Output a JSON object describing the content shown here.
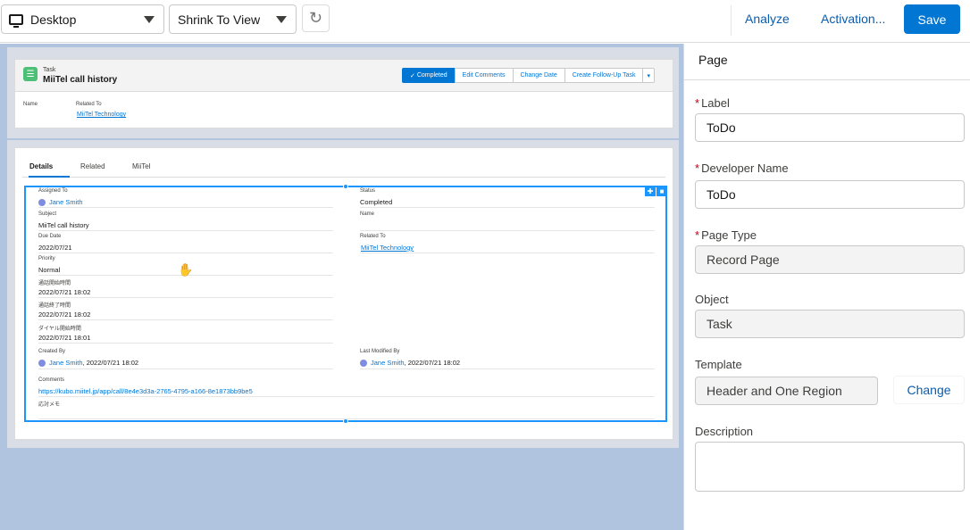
{
  "toolbar": {
    "device_select": "Desktop",
    "view_select": "Shrink To View",
    "refresh_icon": "refresh-icon",
    "analyze": "Analyze",
    "activation": "Activation...",
    "save": "Save"
  },
  "canvas": {
    "header": {
      "object_label": "Task",
      "title": "MiiTel call history",
      "buttons": [
        "Completed",
        "Edit Comments",
        "Change Date",
        "Create Follow-Up Task"
      ],
      "highlights": [
        {
          "label": "Name",
          "value": ""
        },
        {
          "label": "Related To",
          "value": "MiiTel Technology"
        }
      ]
    },
    "tabs": [
      "Details",
      "Related",
      "MiiTel"
    ],
    "fields_left": [
      {
        "label": "Assigned To",
        "value": "Jane Smith",
        "link": true
      },
      {
        "label": "Subject",
        "value": "MiiTel call history",
        "link": false
      },
      {
        "label": "Due Date",
        "value": "2022/07/21",
        "link": false
      },
      {
        "label": "Priority",
        "value": "Normal",
        "link": false
      },
      {
        "label": "通話開始時間",
        "value": "2022/07/21 18:02",
        "link": false
      },
      {
        "label": "通話終了時間",
        "value": "2022/07/21 18:02",
        "link": false
      },
      {
        "label": "ダイヤル開始時間",
        "value": "2022/07/21 18:01",
        "link": false
      }
    ],
    "fields_right": [
      {
        "label": "Status",
        "value": "Completed",
        "link": false
      },
      {
        "label": "Name",
        "value": "",
        "link": false
      },
      {
        "label": "Related To",
        "value": "MiiTel Technology",
        "link": true
      }
    ],
    "created_by": {
      "label": "Created By",
      "name": "Jane Smith",
      "date": ", 2022/07/21 18:02"
    },
    "last_modified_by": {
      "label": "Last Modified By",
      "name": "Jane Smith",
      "date": ", 2022/07/21 18:02"
    },
    "comments": {
      "label": "Comments",
      "value": "https://kubo.miitel.jp/app/call/8e4e3d3a-2765-4795-a166-8e1873bb9be5"
    },
    "memo": {
      "label": "応対メモ",
      "value": ""
    }
  },
  "panel": {
    "title": "Page",
    "label_label": "Label",
    "label_value": "ToDo",
    "dev_name_label": "Developer Name",
    "dev_name_value": "ToDo",
    "page_type_label": "Page Type",
    "page_type_value": "Record Page",
    "object_label": "Object",
    "object_value": "Task",
    "template_label": "Template",
    "template_value": "Header and One Region",
    "change": "Change",
    "description_label": "Description",
    "description_value": ""
  }
}
